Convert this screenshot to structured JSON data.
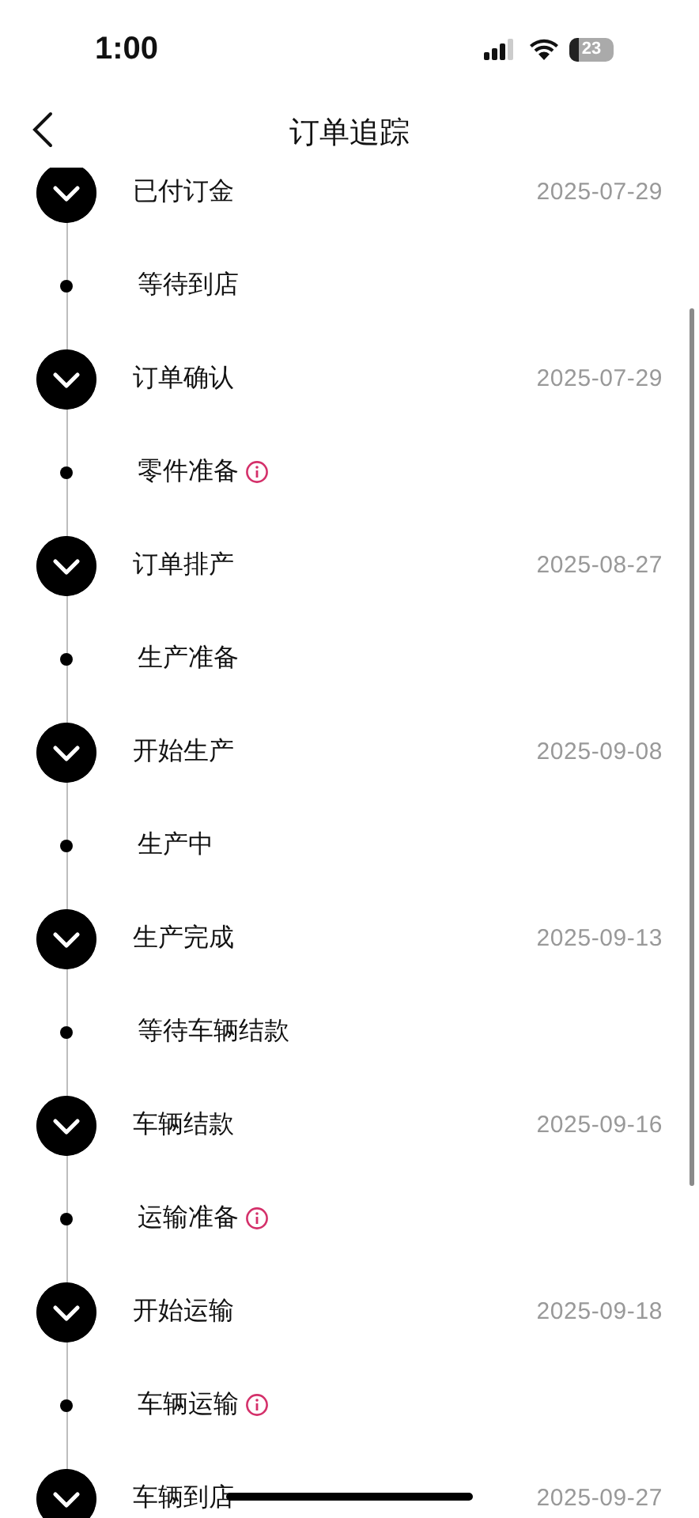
{
  "status_bar": {
    "time": "1:00",
    "battery": "23"
  },
  "header": {
    "title": "订单追踪"
  },
  "steps": [
    {
      "kind": "milestone",
      "label": "已付订金",
      "date": "2025-07-29"
    },
    {
      "kind": "substep",
      "label": "等待到店",
      "info": false
    },
    {
      "kind": "milestone",
      "label": "订单确认",
      "date": "2025-07-29"
    },
    {
      "kind": "substep",
      "label": "零件准备",
      "info": true
    },
    {
      "kind": "milestone",
      "label": "订单排产",
      "date": "2025-08-27"
    },
    {
      "kind": "substep",
      "label": "生产准备",
      "info": false
    },
    {
      "kind": "milestone",
      "label": "开始生产",
      "date": "2025-09-08"
    },
    {
      "kind": "substep",
      "label": "生产中",
      "info": false
    },
    {
      "kind": "milestone",
      "label": "生产完成",
      "date": "2025-09-13"
    },
    {
      "kind": "substep",
      "label": "等待车辆结款",
      "info": false
    },
    {
      "kind": "milestone",
      "label": "车辆结款",
      "date": "2025-09-16"
    },
    {
      "kind": "substep",
      "label": "运输准备",
      "info": true
    },
    {
      "kind": "milestone",
      "label": "开始运输",
      "date": "2025-09-18"
    },
    {
      "kind": "substep",
      "label": "车辆运输",
      "info": true
    },
    {
      "kind": "milestone",
      "label": "车辆到店",
      "date": "2025-09-27"
    }
  ]
}
